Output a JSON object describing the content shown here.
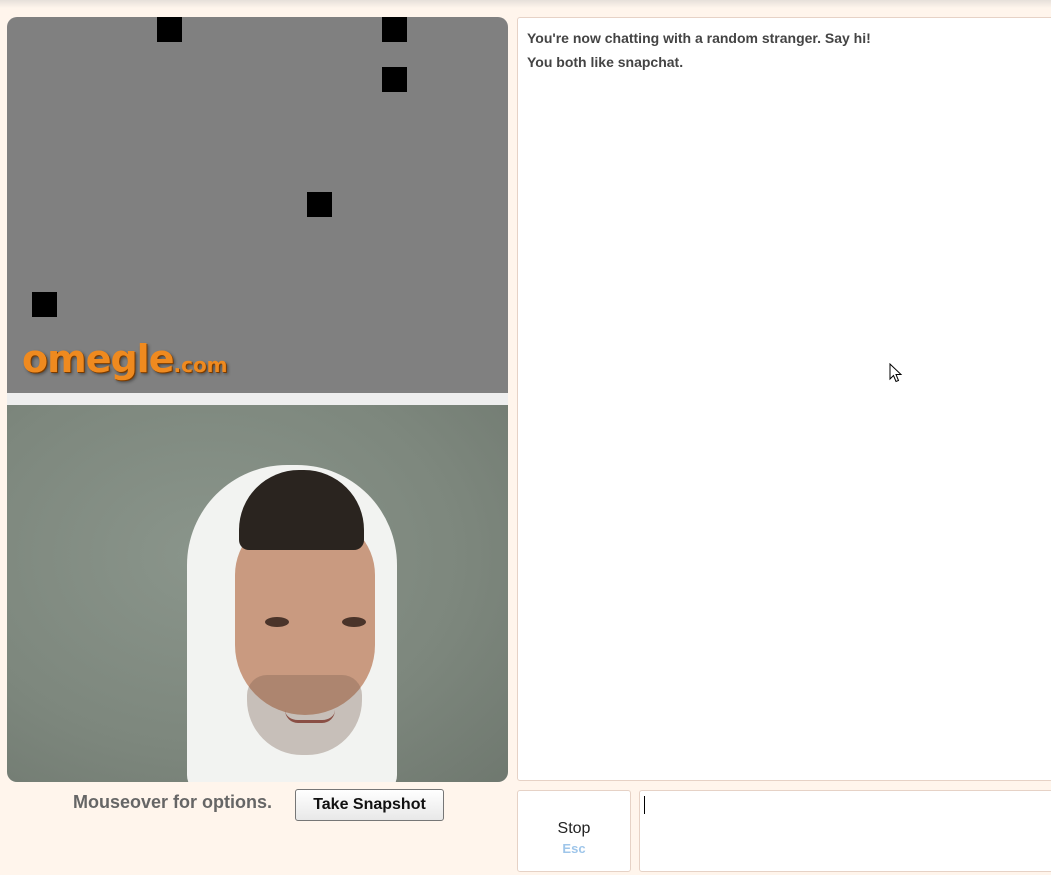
{
  "logo": {
    "main": "omegle",
    "tld": ".com"
  },
  "chat": {
    "messages": [
      "You're now chatting with a random stranger. Say hi!",
      "You both like snapchat."
    ],
    "input_value": ""
  },
  "controls": {
    "options_label": "Mouseover for options.",
    "snapshot_label": "Take Snapshot",
    "stop_label": "Stop",
    "stop_shortcut": "Esc"
  },
  "colors": {
    "page_background": "#fff5ec",
    "logo_orange": "#ef8a1f",
    "shortcut_blue": "#9fc6ea"
  }
}
